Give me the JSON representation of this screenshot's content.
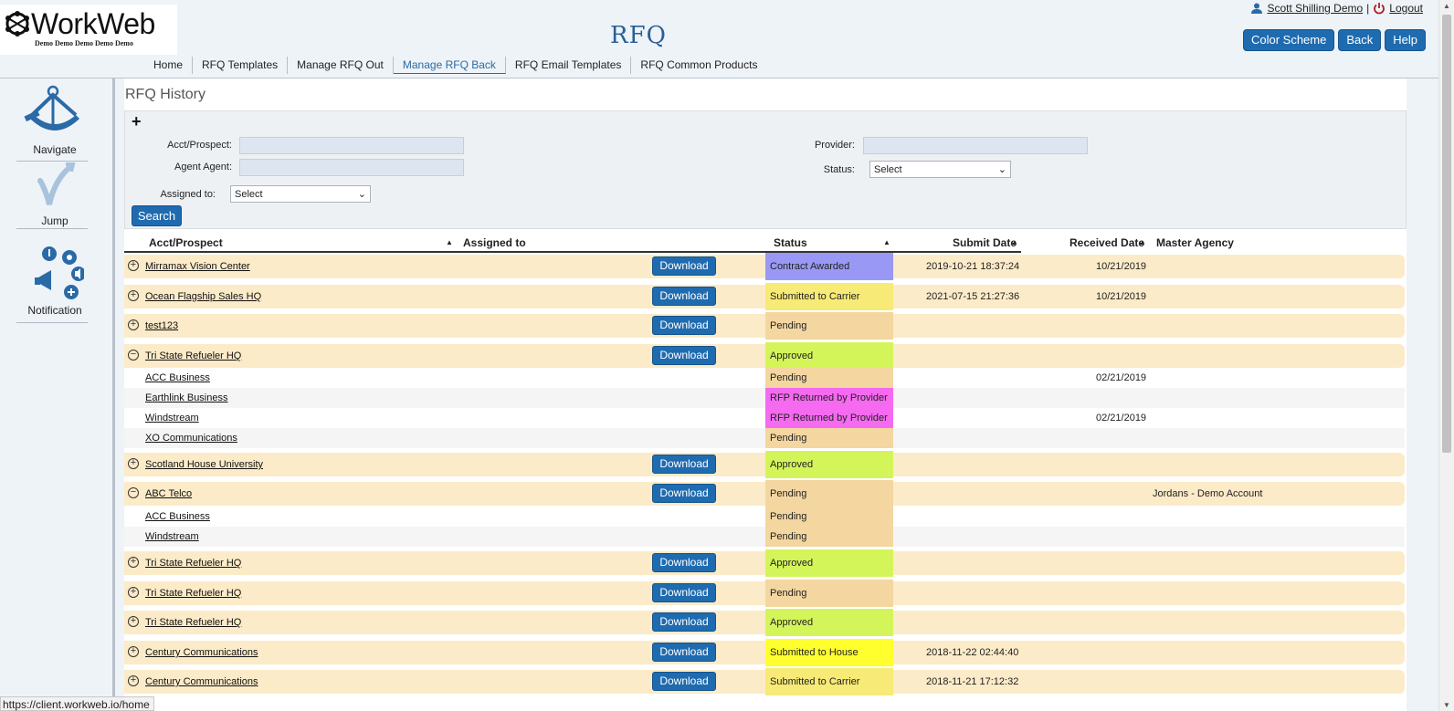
{
  "header": {
    "logo_text": "WorkWeb",
    "logo_subtext": "Demo Demo Demo Demo Demo",
    "page_brand": "RFQ",
    "user_name": "Scott Shilling Demo",
    "logout_label": "Logout",
    "buttons": {
      "color_scheme": "Color Scheme",
      "back": "Back",
      "help": "Help"
    },
    "nav": [
      {
        "label": "Home"
      },
      {
        "label": "RFQ Templates"
      },
      {
        "label": "Manage RFQ Out"
      },
      {
        "label": "Manage RFQ Back",
        "active": true
      },
      {
        "label": "RFQ Email Templates"
      },
      {
        "label": "RFQ Common Products"
      }
    ]
  },
  "sidebar": {
    "navigate": "Navigate",
    "jump": "Jump",
    "notification": "Notification"
  },
  "main": {
    "title": "RFQ History",
    "filters": {
      "expand_symbol": "+",
      "acct_label": "Acct/Prospect:",
      "agent_label": "Agent Agent:",
      "assigned_label": "Assigned to:",
      "assigned_value": "Select",
      "provider_label": "Provider:",
      "status_label": "Status:",
      "status_value": "Select",
      "search_button": "Search"
    },
    "table": {
      "headers": {
        "acct": "Acct/Prospect",
        "assigned": "Assigned to",
        "status": "Status",
        "submit": "Submit Date",
        "received": "Received Date",
        "agency": "Master Agency"
      },
      "download_label": "Download",
      "rows": [
        {
          "name": "Mirramax Vision Center",
          "status": "Contract Awarded",
          "submit": "2019-10-21 18:37:24",
          "received": "10/21/2019",
          "agency": ""
        },
        {
          "name": "Ocean Flagship Sales HQ",
          "status": "Submitted to Carrier",
          "submit": "2021-07-15 21:27:36",
          "received": "10/21/2019",
          "agency": ""
        },
        {
          "name": "test123",
          "status": "Pending",
          "submit": "",
          "received": "",
          "agency": ""
        },
        {
          "name": "Tri State Refueler HQ",
          "status": "Approved",
          "submit": "",
          "received": "",
          "agency": ""
        },
        {
          "name": "ACC Business",
          "status": "Pending",
          "received": "02/21/2019"
        },
        {
          "name": "Earthlink Business",
          "status": "RFP Returned by Provider",
          "received": ""
        },
        {
          "name": "Windstream",
          "status": "RFP Returned by Provider",
          "received": "02/21/2019"
        },
        {
          "name": "XO Communications",
          "status": "Pending",
          "received": ""
        },
        {
          "name": "Scotland House University",
          "status": "Approved",
          "submit": "",
          "received": "",
          "agency": ""
        },
        {
          "name": "ABC Telco",
          "status": "Pending",
          "submit": "",
          "received": "",
          "agency": "Jordans - Demo Account"
        },
        {
          "name": "ACC Business",
          "status": "Pending",
          "received": ""
        },
        {
          "name": "Windstream",
          "status": "Pending",
          "received": ""
        },
        {
          "name": "Tri State Refueler HQ",
          "status": "Approved",
          "submit": "",
          "received": "",
          "agency": ""
        },
        {
          "name": "Tri State Refueler HQ",
          "status": "Pending",
          "submit": "",
          "received": "",
          "agency": ""
        },
        {
          "name": "Tri State Refueler HQ",
          "status": "Approved",
          "submit": "",
          "received": "",
          "agency": ""
        },
        {
          "name": "Century Communications",
          "status": "Submitted to House",
          "submit": "2018-11-22 02:44:40",
          "received": "",
          "agency": ""
        },
        {
          "name": "Century Communications",
          "status": "Submitted to Carrier",
          "submit": "2018-11-21 17:12:32",
          "received": "",
          "agency": ""
        }
      ]
    }
  },
  "status_colors": {
    "Contract Awarded": "#9999f5",
    "Submitted to Carrier": "#f7ea76",
    "Pending": "#f4d6a0",
    "Approved": "#d4f55a",
    "RFP Returned by Provider": "#f56af0",
    "Submitted to House": "#ffff2e"
  },
  "browser_status": "https://client.workweb.io/home"
}
